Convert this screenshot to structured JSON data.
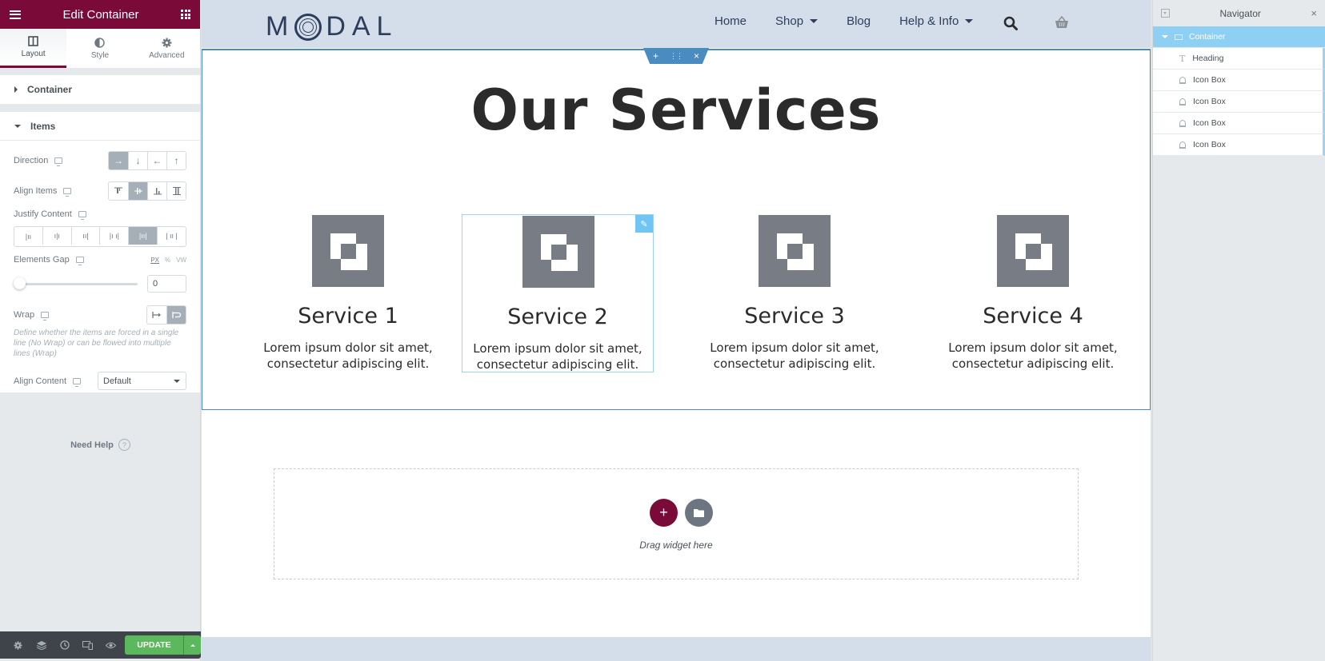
{
  "panel": {
    "title": "Edit Container",
    "tabs": [
      {
        "label": "Layout",
        "icon": "columns-icon",
        "active": true
      },
      {
        "label": "Style",
        "icon": "half-circle-icon",
        "active": false
      },
      {
        "label": "Advanced",
        "icon": "gear-icon",
        "active": false
      }
    ],
    "sections": {
      "container": "Container",
      "items": "Items"
    },
    "controls": {
      "direction": {
        "label": "Direction",
        "options": [
          "→",
          "↓",
          "←",
          "↑"
        ],
        "selected": 0
      },
      "align_items": {
        "label": "Align Items",
        "options": [
          "align-start",
          "align-center",
          "align-end",
          "align-stretch"
        ],
        "selected": 1
      },
      "justify_content": {
        "label": "Justify Content",
        "options": [
          "start",
          "center",
          "end",
          "space-between",
          "space-around",
          "space-evenly"
        ],
        "selected": 4
      },
      "elements_gap": {
        "label": "Elements Gap",
        "units": [
          "PX",
          "%",
          "VW"
        ],
        "selected_unit": "PX",
        "value": "0"
      },
      "wrap": {
        "label": "Wrap",
        "options": [
          "no-wrap",
          "wrap"
        ],
        "selected": 1,
        "description": "Define whether the items are forced in a single line (No Wrap) or can be flowed into multiple lines (Wrap)"
      },
      "align_content": {
        "label": "Align Content",
        "value": "Default"
      }
    },
    "need_help": "Need Help",
    "help_icon": "?",
    "bottom": {
      "icons": [
        "settings-icon",
        "layers-icon",
        "history-icon",
        "responsive-icon",
        "preview-icon"
      ],
      "update_label": "UPDATE"
    }
  },
  "site": {
    "logo": {
      "pre": "M",
      "post": "DAL"
    },
    "nav": [
      {
        "label": "Home",
        "dropdown": false
      },
      {
        "label": "Shop",
        "dropdown": true
      },
      {
        "label": "Blog",
        "dropdown": false
      },
      {
        "label": "Help & Info",
        "dropdown": true
      }
    ],
    "heading": "Our Services",
    "services": [
      {
        "title": "Service 1",
        "text": "Lorem ipsum dolor sit amet, consectetur adipiscing elit."
      },
      {
        "title": "Service 2",
        "text": "Lorem ipsum dolor sit amet, consectetur adipiscing elit."
      },
      {
        "title": "Service 3",
        "text": "Lorem ipsum dolor sit amet, consectetur adipiscing elit."
      },
      {
        "title": "Service 4",
        "text": "Lorem ipsum dolor sit amet, consectetur adipiscing elit."
      }
    ],
    "dropzone_text": "Drag widget here",
    "toolbar": {
      "add": "+",
      "move": "⋮⋮",
      "close": "×"
    }
  },
  "navigator": {
    "title": "Navigator",
    "close": "×",
    "root": "Container",
    "children": [
      "Heading",
      "Icon Box",
      "Icon Box",
      "Icon Box",
      "Icon Box"
    ]
  },
  "colors": {
    "brand": "#7a0b38",
    "update_green": "#5cb85c",
    "selection_blue": "#4a8cc0",
    "navigator_active": "#8ed0f3",
    "site_header": "#d4deea"
  }
}
